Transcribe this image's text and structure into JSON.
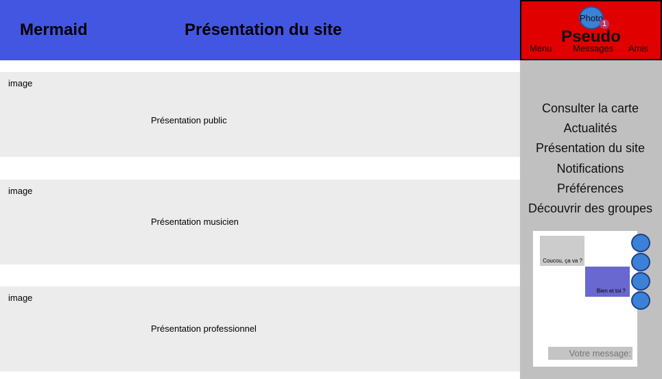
{
  "header": {
    "brand": "Mermaid",
    "title": "Présentation du site",
    "header_color": "#4356e2"
  },
  "profile": {
    "photo_label": "Photo",
    "notification_count": "1",
    "pseudo": "Pseudo",
    "nav": [
      "Menu",
      "Messages",
      "Amis"
    ],
    "background_color": "#e00000"
  },
  "sections": [
    {
      "image_label": "image",
      "text": "Présentation public"
    },
    {
      "image_label": "image",
      "text": "Présentation musicien"
    },
    {
      "image_label": "image",
      "text": "Présentation professionnel"
    }
  ],
  "sidebar": {
    "menu": [
      "Consulter la carte",
      "Actualités",
      "Présentation du site",
      "Notifications",
      "Préférences",
      "Découvrir des groupes"
    ]
  },
  "chat": {
    "messages": [
      {
        "from": "other",
        "text": "Coucou, ça va ?"
      },
      {
        "from": "me",
        "text": "Bien et toi ?"
      }
    ],
    "contact_avatars": 4,
    "input_placeholder": "Votre message:"
  }
}
